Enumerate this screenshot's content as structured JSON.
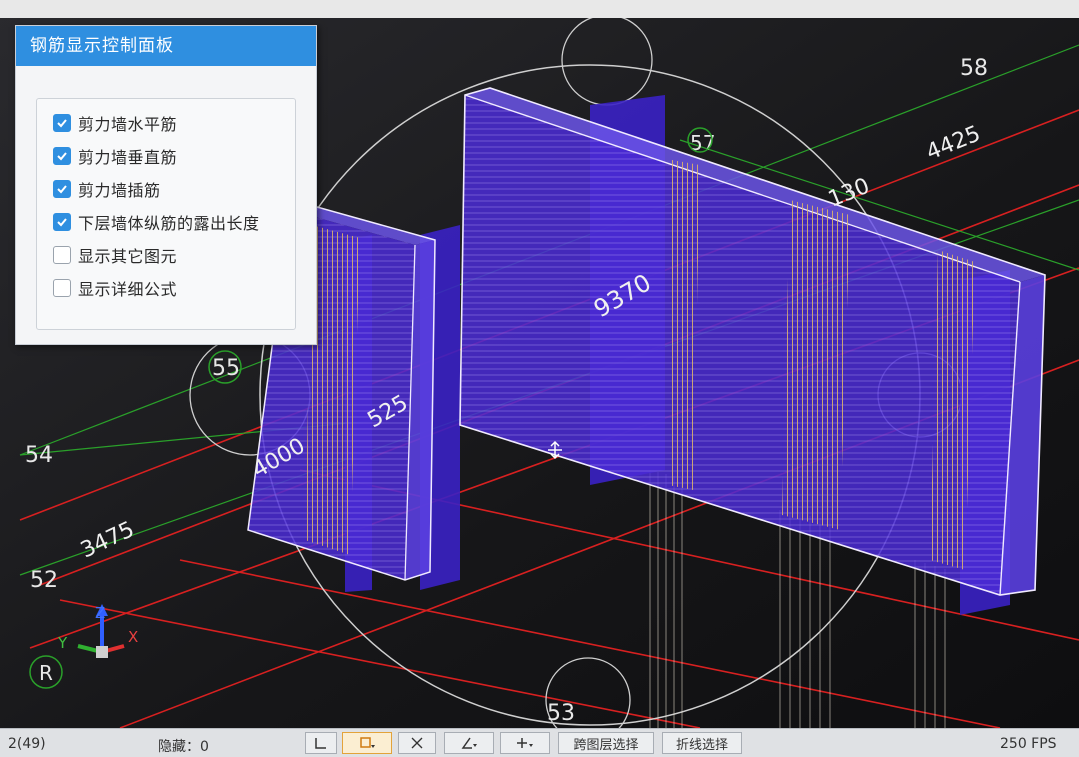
{
  "panel": {
    "title": "钢筋显示控制面板",
    "options": [
      {
        "label": "剪力墙水平筋",
        "checked": true
      },
      {
        "label": "剪力墙垂直筋",
        "checked": true
      },
      {
        "label": "剪力墙插筋",
        "checked": true
      },
      {
        "label": "下层墙体纵筋的露出长度",
        "checked": true
      },
      {
        "label": "显示其它图元",
        "checked": false
      },
      {
        "label": "显示详细公式",
        "checked": false
      }
    ]
  },
  "viewport": {
    "axis_labels": {
      "grid_58": "58",
      "grid_57": "57",
      "grid_55": "55",
      "grid_54": "54",
      "grid_52": "52",
      "grid_53": "53"
    },
    "dimensions": {
      "d4425": "4425",
      "d130": "130",
      "d9370": "9370",
      "d525": "525",
      "d4000": "4000",
      "d3475": "3475"
    },
    "gizmo": {
      "x": "X",
      "y": "Y",
      "z": "Z"
    },
    "corner_label": "R"
  },
  "statusbar": {
    "selection_count": "2(49)",
    "hidden_count": "隐藏：0",
    "layer_select": "跨图层选择",
    "polyline_select": "折线选择",
    "fps": "250 FPS"
  },
  "colors": {
    "panel_header": "#2f8fe0",
    "wall_fill": "#4b2bd6",
    "gridline_red": "#d82020",
    "gridline_green": "#2aa02a"
  }
}
